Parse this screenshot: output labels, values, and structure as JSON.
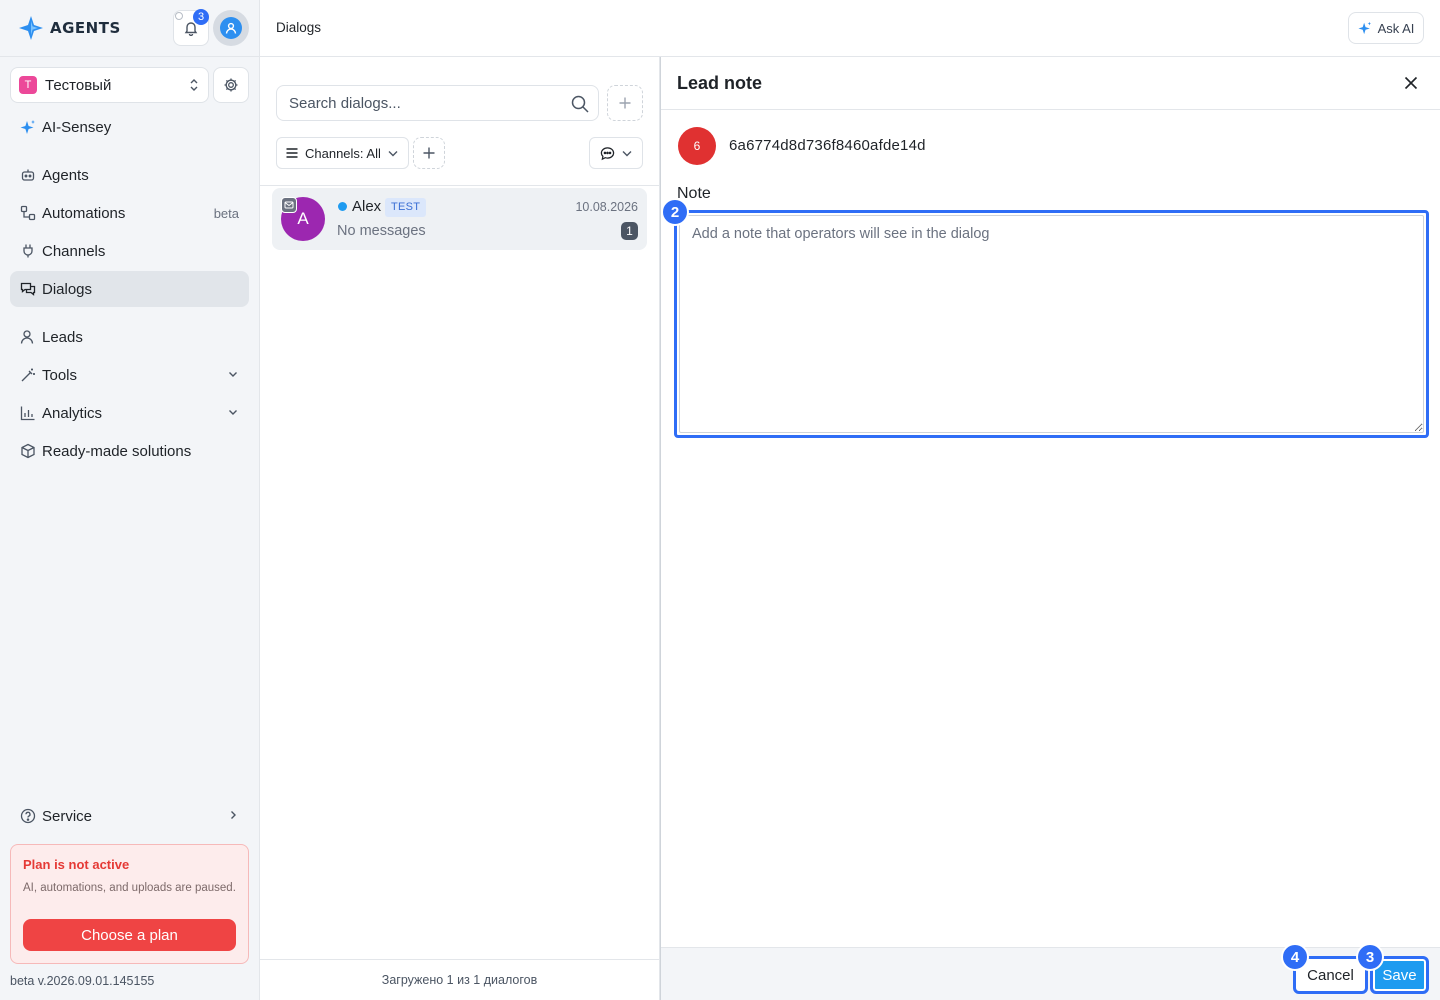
{
  "app": {
    "brand": "AGENTS",
    "notifications_count": "3",
    "colors": {
      "accent": "#2f6df6",
      "danger": "#ef4444",
      "online": "#1e9bf0"
    }
  },
  "sidebar": {
    "workspace": {
      "initial": "Т",
      "name": "Тестовый"
    },
    "items": [
      {
        "label": "AI-Sensey",
        "icon": "sparkle-icon"
      },
      {
        "label": "Agents",
        "icon": "bot-icon"
      },
      {
        "label": "Automations",
        "icon": "workflow-icon",
        "tail": "beta"
      },
      {
        "label": "Channels",
        "icon": "plug-icon"
      },
      {
        "label": "Dialogs",
        "icon": "chat-icon",
        "active": true
      },
      {
        "label": "Leads",
        "icon": "user-icon"
      },
      {
        "label": "Tools",
        "icon": "wand-icon"
      },
      {
        "label": "Analytics",
        "icon": "chart-icon"
      },
      {
        "label": "Ready-made solutions",
        "icon": "package-icon"
      }
    ],
    "service": "Service",
    "plan": {
      "title": "Plan is not active",
      "description": "AI, automations, and uploads are paused.",
      "button": "Choose a plan"
    },
    "version": "beta v.2026.09.01.145155"
  },
  "topbar": {
    "breadcrumb": "Dialogs",
    "ask_ai": "Ask AI"
  },
  "dialogs": {
    "search_placeholder": "Search dialogs...",
    "channels_filter": "Channels: All",
    "rows": [
      {
        "avatar_initial": "A",
        "name": "Alex",
        "tag": "TEST",
        "date": "10.08.2026",
        "preview": "No messages",
        "unread": "1"
      }
    ],
    "footer": "Загружено 1 из 1 диалогов"
  },
  "lead_note": {
    "title": "Lead note",
    "avatar_text": "6",
    "lead_id": "6a6774d8d736f8460afde14d",
    "note_label": "Note",
    "note_placeholder": "Add a note that operators will see in the dialog",
    "note_value": "",
    "cancel": "Cancel",
    "save": "Save"
  },
  "markers": {
    "note_field": "2",
    "save": "3",
    "cancel": "4"
  }
}
